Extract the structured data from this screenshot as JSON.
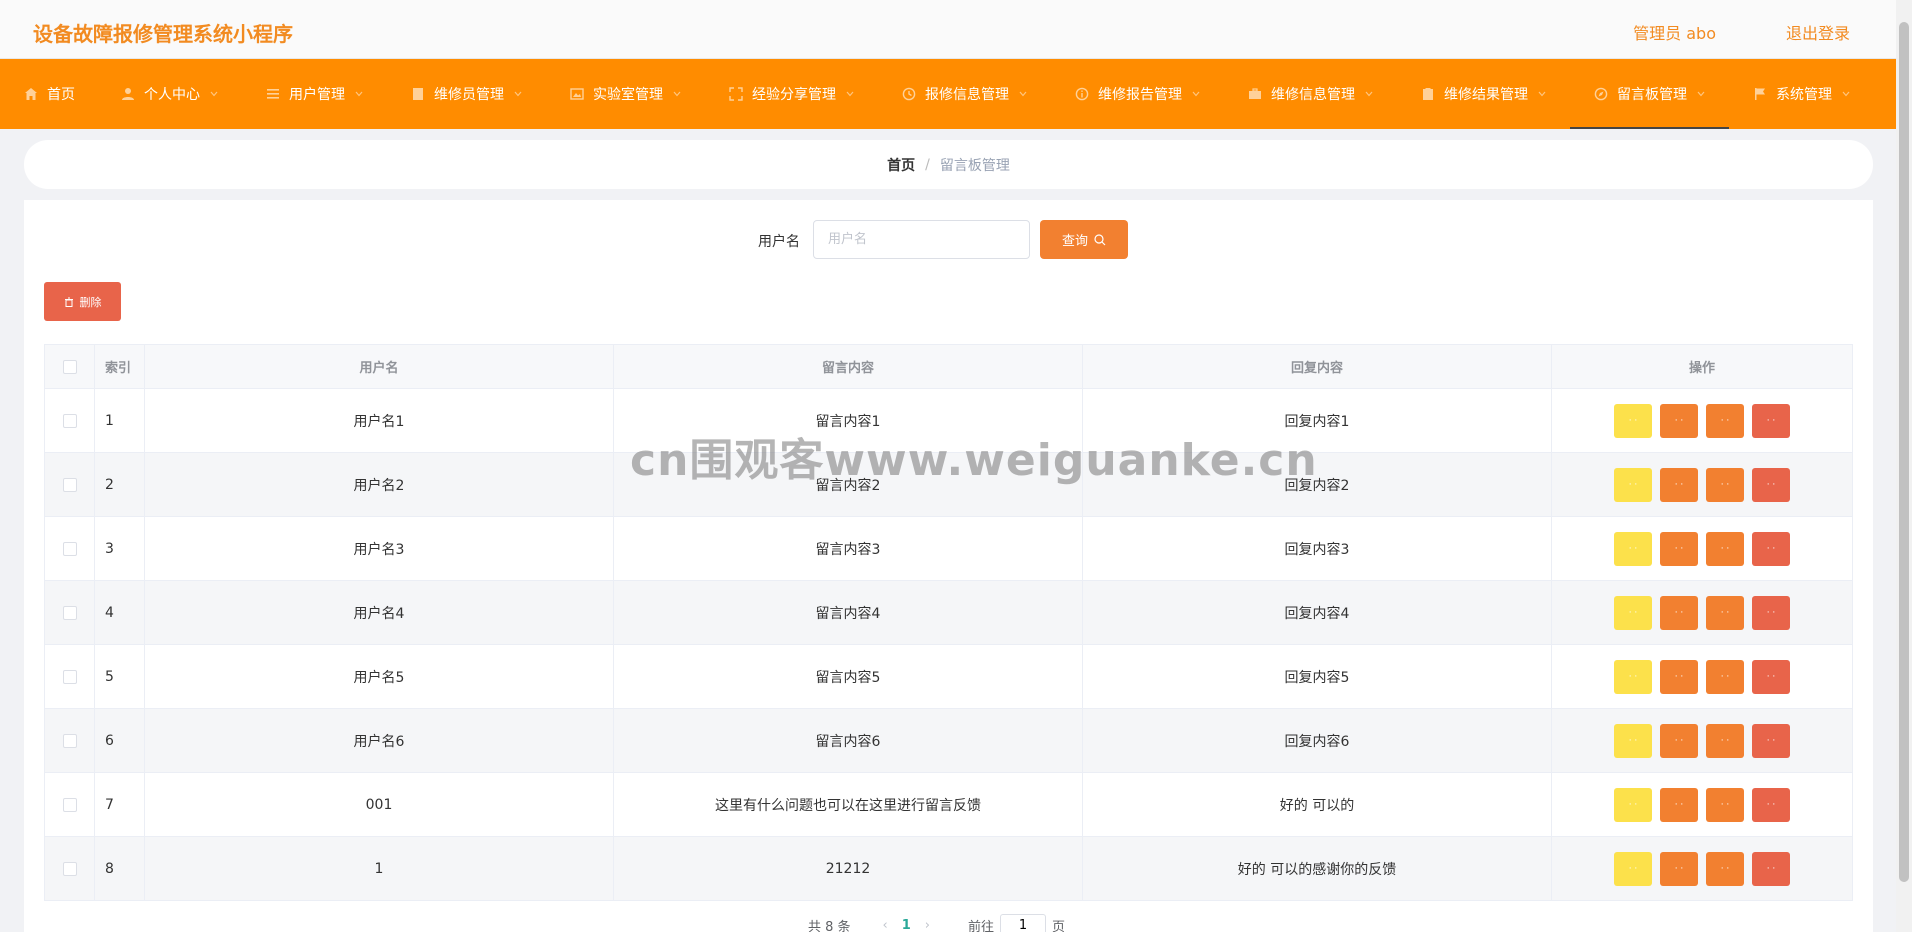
{
  "header": {
    "app_title": "设备故障报修管理系统小程序",
    "user_info": "管理员 abo",
    "logout_label": "退出登录"
  },
  "nav": {
    "items": [
      {
        "label": "首页",
        "icon": "home-icon",
        "has_dropdown": false
      },
      {
        "label": "个人中心",
        "icon": "user-icon",
        "has_dropdown": true
      },
      {
        "label": "用户管理",
        "icon": "list-icon",
        "has_dropdown": true
      },
      {
        "label": "维修员管理",
        "icon": "document-icon",
        "has_dropdown": true
      },
      {
        "label": "实验室管理",
        "icon": "image-icon",
        "has_dropdown": true
      },
      {
        "label": "经验分享管理",
        "icon": "fullscreen-icon",
        "has_dropdown": true
      },
      {
        "label": "报修信息管理",
        "icon": "clock-icon",
        "has_dropdown": true
      },
      {
        "label": "维修报告管理",
        "icon": "info-icon",
        "has_dropdown": true
      },
      {
        "label": "维修信息管理",
        "icon": "briefcase-icon",
        "has_dropdown": true
      },
      {
        "label": "维修结果管理",
        "icon": "clipboard-icon",
        "has_dropdown": true
      },
      {
        "label": "留言板管理",
        "icon": "compass-icon",
        "has_dropdown": true
      },
      {
        "label": "系统管理",
        "icon": "flag-icon",
        "has_dropdown": true
      }
    ],
    "active_index": 10
  },
  "breadcrumb": {
    "home": "首页",
    "separator": "/",
    "current": "留言板管理"
  },
  "search": {
    "label": "用户名",
    "placeholder": "用户名",
    "value": "",
    "button_label": "查询"
  },
  "toolbar": {
    "delete_label": "删除"
  },
  "table": {
    "headers": [
      "索引",
      "用户名",
      "留言内容",
      "回复内容",
      "操作"
    ],
    "rows": [
      {
        "index": "1",
        "username": "用户名1",
        "message": "留言内容1",
        "reply": "回复内容1"
      },
      {
        "index": "2",
        "username": "用户名2",
        "message": "留言内容2",
        "reply": "回复内容2"
      },
      {
        "index": "3",
        "username": "用户名3",
        "message": "留言内容3",
        "reply": "回复内容3"
      },
      {
        "index": "4",
        "username": "用户名4",
        "message": "留言内容4",
        "reply": "回复内容4"
      },
      {
        "index": "5",
        "username": "用户名5",
        "message": "留言内容5",
        "reply": "回复内容5"
      },
      {
        "index": "6",
        "username": "用户名6",
        "message": "留言内容6",
        "reply": "回复内容6"
      },
      {
        "index": "7",
        "username": "001",
        "message": "这里有什么问题也可以在这里进行留言反馈",
        "reply": "好的 可以的"
      },
      {
        "index": "8",
        "username": "1",
        "message": "21212",
        "reply": "好的 可以的感谢你的反馈"
      }
    ]
  },
  "pagination": {
    "total_text": "共 8 条",
    "current_page": "1",
    "goto_label": "前往",
    "goto_value": "1",
    "page_unit": "页"
  },
  "watermark": "cn围观客www.weiguanke.cn",
  "colors": {
    "brand": "#ff8c00",
    "title": "#f28b21",
    "button_orange": "#f28030",
    "button_yellow": "#fce14b",
    "button_red": "#e8644a",
    "page_active": "#2aa898"
  }
}
